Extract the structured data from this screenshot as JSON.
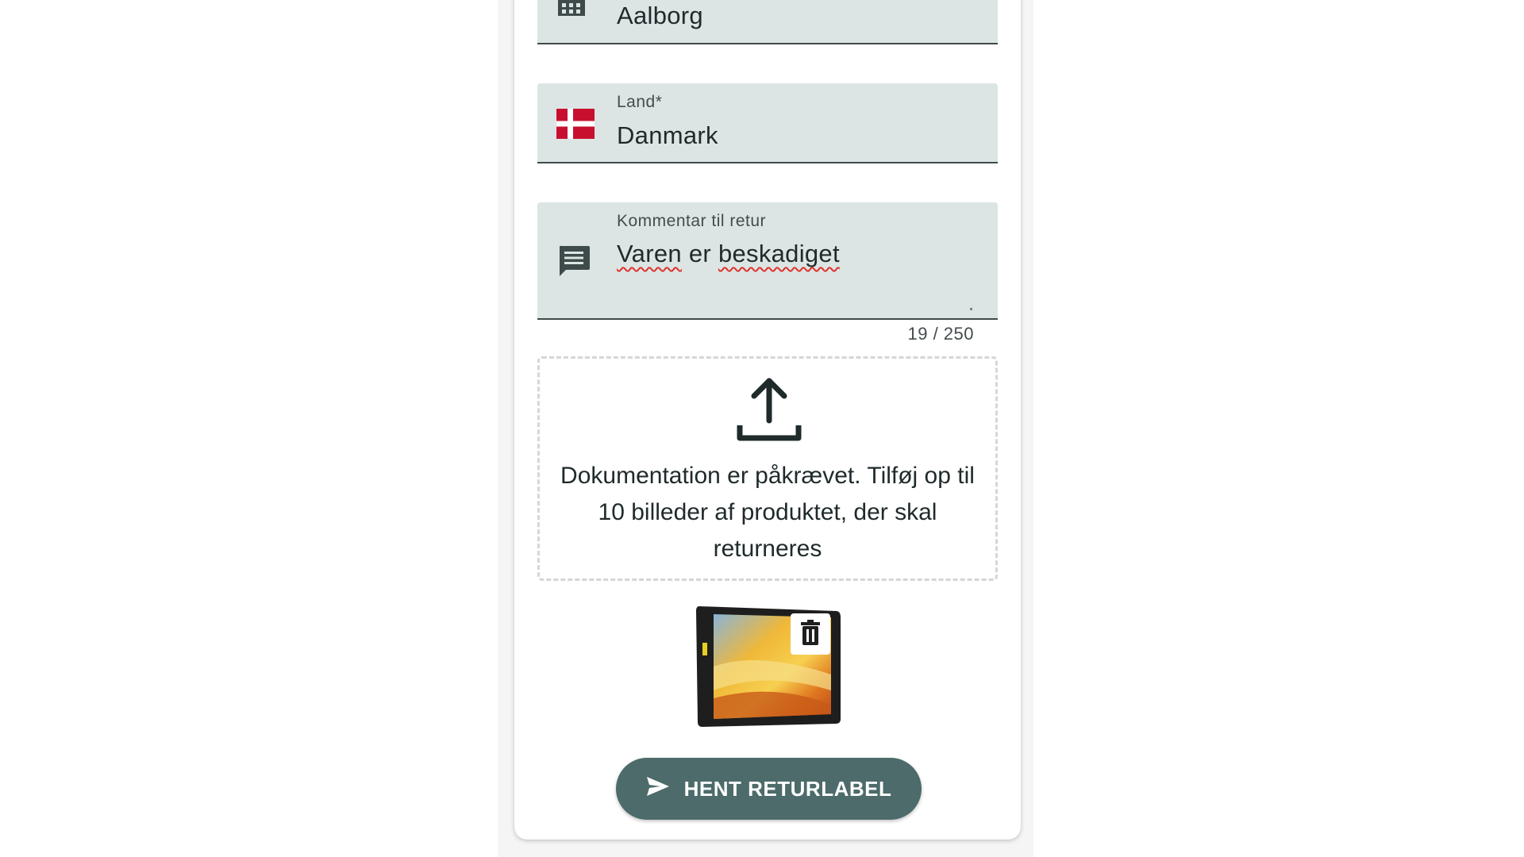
{
  "city_field": {
    "value": "Aalborg",
    "icon": "city-icon"
  },
  "country_field": {
    "label": "Land*",
    "value": "Danmark",
    "icon": "denmark-flag-icon",
    "flag_color": "#c8102e"
  },
  "comment_field": {
    "label": "Kommentar til retur",
    "value_word1": "Varen",
    "value_word2": "er",
    "value_word3": "beskadiget",
    "icon": "comment-icon",
    "counter": "19 / 250"
  },
  "upload": {
    "icon": "upload-icon",
    "message": "Dokumentation er påkrævet. Tilføj op til 10 billeder af produktet, der skal returneres"
  },
  "attachment": {
    "image": "product-tablet-thumbnail",
    "delete_icon": "trash-icon"
  },
  "submit_button": {
    "label": "HENT RETURLABEL",
    "icon": "send-icon"
  },
  "colors": {
    "field_bg": "#dce5e4",
    "button_bg": "#4c6b6a"
  }
}
